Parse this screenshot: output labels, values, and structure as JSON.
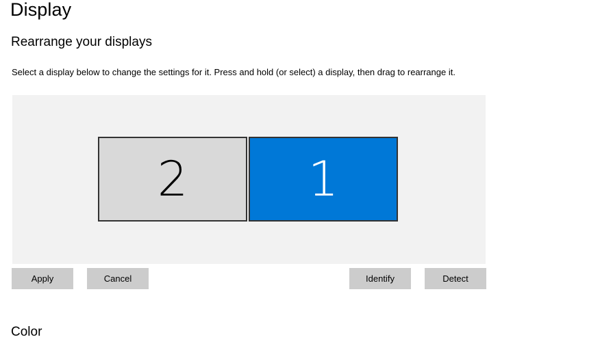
{
  "page": {
    "title": "Display"
  },
  "rearrange": {
    "heading": "Rearrange your displays",
    "description": "Select a display below to change the settings for it. Press and hold (or select) a display, then drag to rearrange it.",
    "displays": [
      {
        "number": "2",
        "selected": false
      },
      {
        "number": "1",
        "selected": true
      }
    ],
    "buttons": {
      "apply": "Apply",
      "cancel": "Cancel",
      "identify": "Identify",
      "detect": "Detect"
    }
  },
  "color": {
    "heading": "Color"
  },
  "colors": {
    "accent": "#0078d7",
    "area_background": "#f2f2f2",
    "unselected_display": "#d9d9d9",
    "button_background": "#cccccc"
  }
}
